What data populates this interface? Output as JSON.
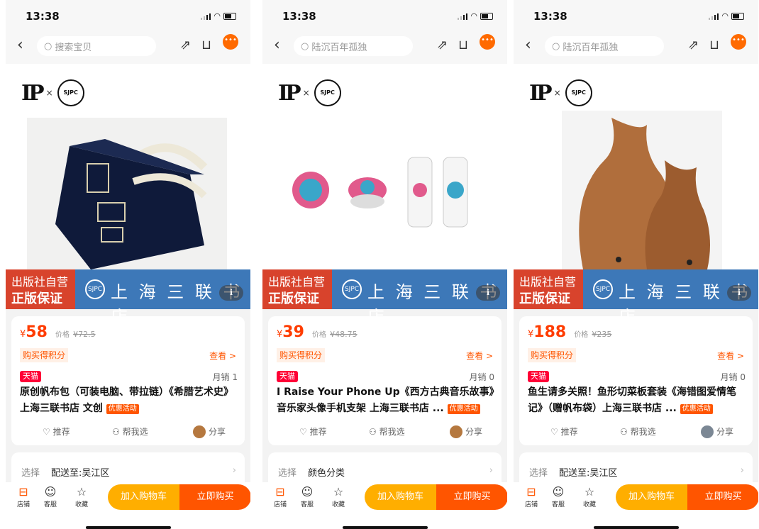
{
  "status": {
    "time": "13:38"
  },
  "banner": {
    "tag_line1": "出版社自营",
    "tag_line2": "正版保证",
    "seal": "SJPC",
    "brand": "上 海 三 联 书 店"
  },
  "labels": {
    "price_label": "价格",
    "points": "购买得积分",
    "view": "查看 >",
    "tmall": "天猫",
    "promo": "优惠活动",
    "recommend": "推荐",
    "help_choose": "帮我选",
    "share": "分享",
    "select": "选择",
    "store": "店铺",
    "service": "客服",
    "favorite": "收藏",
    "add_cart": "加入购物车",
    "buy_now": "立即购买",
    "logo_x": "×",
    "logo_ip": "IP"
  },
  "colors": {
    "accent": "#ff5500",
    "tmall": "#ff0036",
    "banner_blue": "#3d78b8",
    "banner_red": "#d8432c",
    "add_cart": "#ffae00"
  },
  "screens": [
    {
      "search_placeholder": "搜索宝贝",
      "currency": "¥",
      "price": "58",
      "original_price": "¥72.5",
      "sales": "月销 1",
      "title": "原创帆布包（可装电脑、带拉链）《希腊艺术史》上海三联书店 文创",
      "option": "配送至:吴江区",
      "share_avatar": "brown"
    },
    {
      "search_placeholder": "陆沉百年孤独",
      "currency": "¥",
      "price": "39",
      "original_price": "¥48.75",
      "sales": "月销 0",
      "title": "I Raise Your Phone Up《西方古典音乐故事》音乐家头像手机支架 上海三联书店 ...",
      "option": "颜色分类",
      "share_avatar": "brown"
    },
    {
      "search_placeholder": "陆沉百年孤独",
      "currency": "¥",
      "price": "188",
      "original_price": "¥235",
      "sales": "月销 0",
      "title": "鱼生请多关照！鱼形切菜板套装《海错图爱情笔记》（赠帆布袋）上海三联书店 ...",
      "option": "配送至:吴江区",
      "share_avatar": "grey"
    }
  ]
}
